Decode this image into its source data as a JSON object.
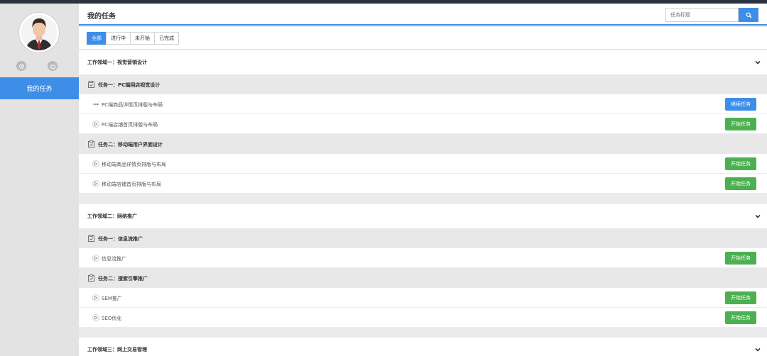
{
  "sidebar": {
    "avatar_icon": "user-avatar",
    "settings_icon": "gear-icon",
    "power_icon": "power-icon",
    "nav_item": "我的任务"
  },
  "header": {
    "title": "我的任务",
    "search_placeholder": "任务标题",
    "search_icon": "search-icon"
  },
  "tabs": [
    {
      "label": "全部",
      "active": true
    },
    {
      "label": "进行中",
      "active": false
    },
    {
      "label": "未开始",
      "active": false
    },
    {
      "label": "已完成",
      "active": false
    }
  ],
  "areas": [
    {
      "title": "工作领域一：视觉营销设计",
      "tasks": [
        {
          "label": "任务一：PC端网店视觉设计",
          "items": [
            {
              "label": "PC端商品详情页排版与布局",
              "status": "in-progress",
              "button": "继续任务"
            },
            {
              "label": "PC端店铺首页排版与布局",
              "status": "not-started",
              "button": "开始任务"
            }
          ]
        },
        {
          "label": "任务二：移动端用户界面设计",
          "items": [
            {
              "label": "移动端商品详情页排版与布局",
              "status": "not-started",
              "button": "开始任务"
            },
            {
              "label": "移动端店铺首页排版与布局",
              "status": "not-started",
              "button": "开始任务"
            }
          ]
        }
      ]
    },
    {
      "title": "工作领域二：网络推广",
      "tasks": [
        {
          "label": "任务一：信息流推广",
          "items": [
            {
              "label": "信息流推广",
              "status": "not-started",
              "button": "开始任务"
            }
          ]
        },
        {
          "label": "任务二：搜索引擎推广",
          "items": [
            {
              "label": "SEM推广",
              "status": "not-started",
              "button": "开始任务"
            },
            {
              "label": "SEO优化",
              "status": "not-started",
              "button": "开始任务"
            }
          ]
        }
      ]
    },
    {
      "title": "工作领域三：网上交易管理",
      "tasks": []
    }
  ],
  "colors": {
    "accent": "#3e8ee8",
    "start_button": "#4cb050",
    "continue_button": "#3e8ee8",
    "topbar": "#2b3240"
  }
}
